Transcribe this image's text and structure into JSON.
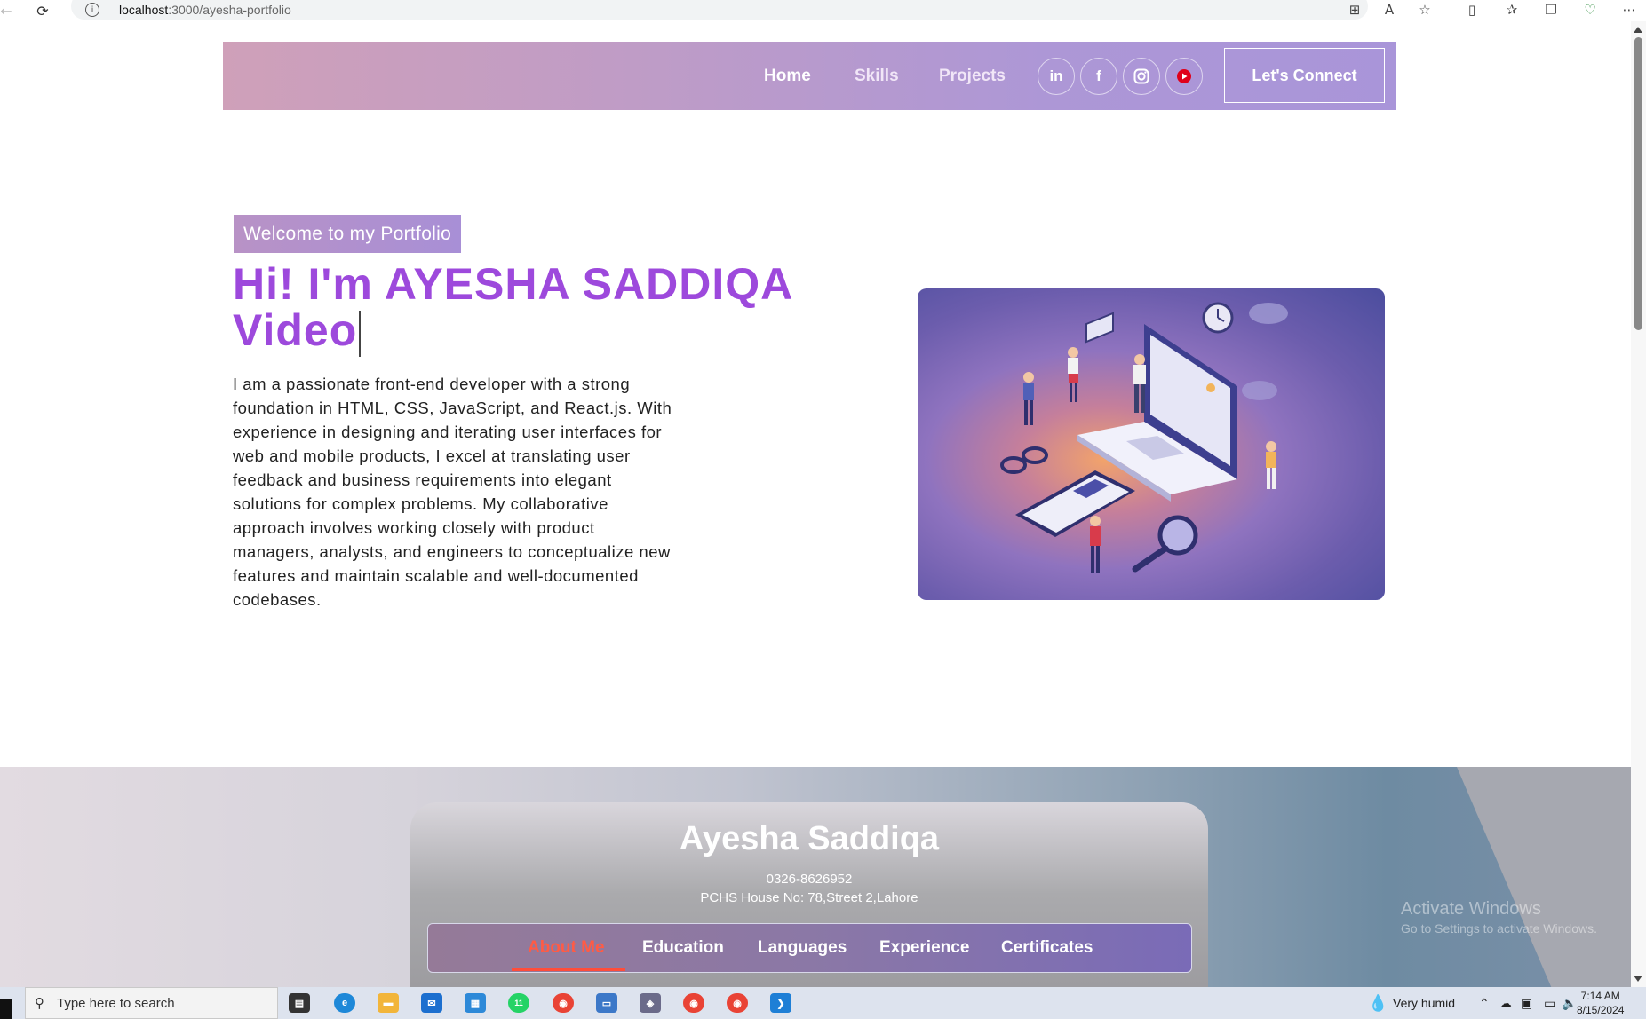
{
  "browser": {
    "url_host": "localhost",
    "url_path": ":3000/ayesha-portfolio"
  },
  "navbar": {
    "links": [
      "Home",
      "Skills",
      "Projects"
    ],
    "social": [
      "in",
      "f",
      "instagram-icon",
      "youtube-icon"
    ],
    "connect_label": "Let's Connect"
  },
  "hero": {
    "tagline": "Welcome to my Portfolio",
    "title_line1": "Hi! I'm AYESHA SADDIQA",
    "title_line2": "Video",
    "description": "I am a passionate front-end developer with a strong foundation in HTML, CSS, JavaScript, and React.js. With experience in designing and iterating user interfaces for web and mobile products, I excel at translating user feedback and business requirements into elegant solutions for complex problems. My collaborative approach involves working closely with product managers, analysts, and engineers to conceptualize new features and maintain scalable and well-documented codebases."
  },
  "profile": {
    "name": "Ayesha Saddiqa",
    "phone": "0326-8626952",
    "address": "PCHS House No: 78,Street 2,Lahore",
    "tabs": [
      "About Me",
      "Education",
      "Languages",
      "Experience",
      "Certificates"
    ],
    "active_tab": "About Me"
  },
  "watermark": {
    "line1": "Activate Windows",
    "line2": "Go to Settings to activate Windows."
  },
  "taskbar": {
    "search_placeholder": "Type here to search",
    "weather": "Very humid",
    "time": "7:14 AM",
    "date": "8/15/2024",
    "whatsapp_badge": "11"
  },
  "colors": {
    "accent_purple": "#9d49dc",
    "active_tab": "#ff5b45"
  }
}
